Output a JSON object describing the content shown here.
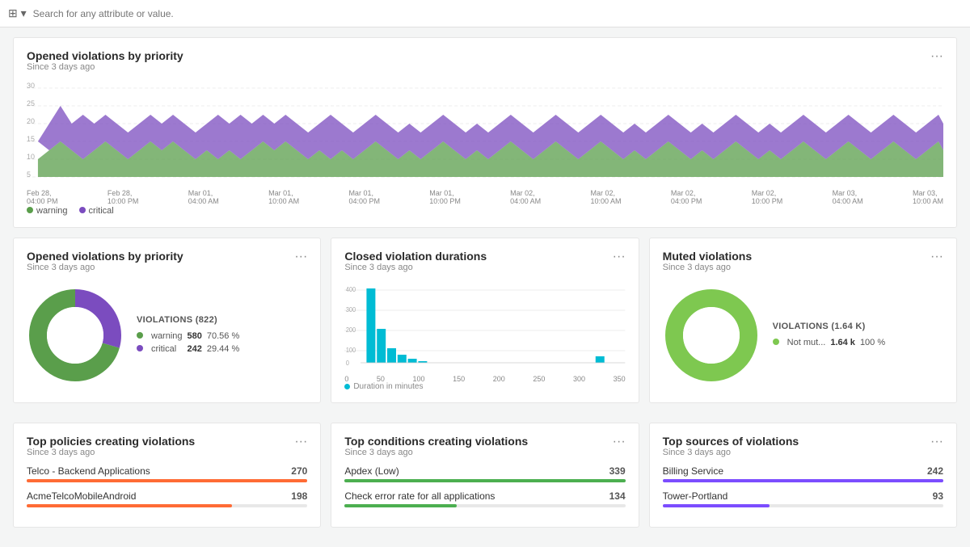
{
  "topbar": {
    "search_placeholder": "Search for any attribute or value."
  },
  "main_chart": {
    "title": "Opened violations by priority",
    "subtitle": "Since 3 days ago",
    "x_labels": [
      "Feb 28,\n04:00 PM",
      "Feb 28,\n10:00 PM",
      "Mar 01,\n04:00 AM",
      "Mar 01,\n10:00 AM",
      "Mar 01,\n04:00 PM",
      "Mar 01,\n10:00 PM",
      "Mar 02,\n04:00 AM",
      "Mar 02,\n10:00 AM",
      "Mar 02,\n04:00 PM",
      "Mar 02,\n10:00 PM",
      "Mar 03,\n04:00 AM",
      "Mar 03,\n10:00 AM"
    ],
    "legend": [
      {
        "label": "warning",
        "color": "#5a9e4b"
      },
      {
        "label": "critical",
        "color": "#7b4cbf"
      }
    ]
  },
  "opened_by_priority": {
    "title": "Opened violations by priority",
    "subtitle": "Since 3 days ago",
    "violations_label": "VIOLATIONS (822)",
    "items": [
      {
        "label": "warning",
        "value": 580,
        "pct": "70.56 %",
        "color": "#5a9e4b"
      },
      {
        "label": "critical",
        "value": 242,
        "pct": "29.44 %",
        "color": "#7b4cbf"
      }
    ]
  },
  "closed_durations": {
    "title": "Closed violation durations",
    "subtitle": "Since 3 days ago",
    "duration_label": "Duration in minutes",
    "x_labels": [
      "0",
      "50",
      "100",
      "150",
      "200",
      "250",
      "300",
      "350"
    ]
  },
  "muted_violations": {
    "title": "Muted violations",
    "subtitle": "Since 3 days ago",
    "violations_label": "VIOLATIONS (1.64 K)",
    "items": [
      {
        "label": "Not mut...",
        "value": "1.64 k",
        "pct": "100 %",
        "color": "#7ec850"
      }
    ]
  },
  "top_policies": {
    "title": "Top policies creating violations",
    "subtitle": "Since 3 days ago",
    "items": [
      {
        "name": "Telco - Backend Applications",
        "value": 270,
        "max": 270,
        "color": "#ff6b35"
      },
      {
        "name": "AcmeTelcoMobileAndroid",
        "value": 198,
        "max": 270,
        "color": "#ff6b35"
      }
    ]
  },
  "top_conditions": {
    "title": "Top conditions creating violations",
    "subtitle": "Since 3 days ago",
    "items": [
      {
        "name": "Apdex (Low)",
        "value": 339,
        "max": 339,
        "color": "#4caf50"
      },
      {
        "name": "Check error rate for all applications",
        "value": 134,
        "max": 339,
        "color": "#4caf50"
      }
    ]
  },
  "top_sources": {
    "title": "Top sources of violations",
    "subtitle": "Since 3 days ago",
    "items": [
      {
        "name": "Billing Service",
        "value": 242,
        "max": 242,
        "color": "#7c4dff"
      },
      {
        "name": "Tower-Portland",
        "value": 93,
        "max": 242,
        "color": "#7c4dff"
      }
    ]
  }
}
